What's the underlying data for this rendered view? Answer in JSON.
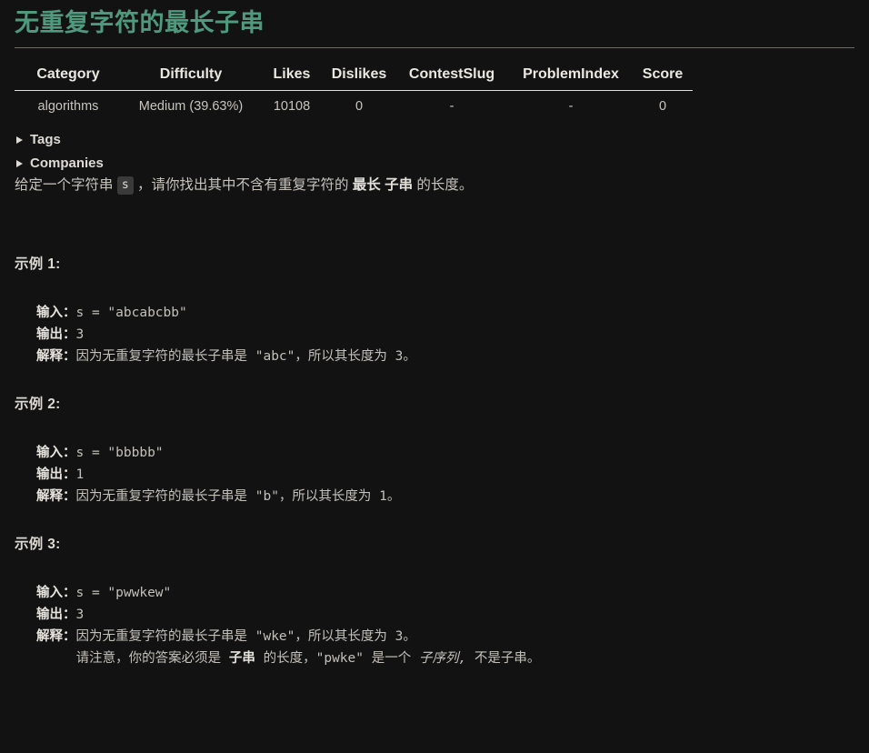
{
  "problem": {
    "title": "无重复字符的最长子串"
  },
  "meta_table": {
    "headers": [
      "Category",
      "Difficulty",
      "Likes",
      "Dislikes",
      "ContestSlug",
      "ProblemIndex",
      "Score"
    ],
    "row": {
      "category": "algorithms",
      "difficulty": "Medium (39.63%)",
      "likes": "10108",
      "dislikes": "0",
      "contest_slug": "-",
      "problem_index": "-",
      "score": "0"
    }
  },
  "disclosures": {
    "tags_label": "Tags",
    "companies_label": "Companies"
  },
  "description": {
    "part1": "给定一个字符串 ",
    "code_s": "s",
    "part2": " ，请你找出其中不含有重复字符的 ",
    "bold1": "最长",
    "part3": " ",
    "bold2": "子串",
    "part4": " 的长度。"
  },
  "examples": [
    {
      "heading": "示例 1:",
      "input_label": "输入：",
      "input_value": "s = \"abcabcbb\"",
      "output_label": "输出：",
      "output_value": "3",
      "explain_label": "解释：",
      "explain_value": "因为无重复字符的最长子串是 \"abc\"，所以其长度为 3。",
      "explain_extra": ""
    },
    {
      "heading": "示例 2:",
      "input_label": "输入：",
      "input_value": "s = \"bbbbb\"",
      "output_label": "输出：",
      "output_value": "1",
      "explain_label": "解释：",
      "explain_value": "因为无重复字符的最长子串是 \"b\"，所以其长度为 1。",
      "explain_extra": ""
    },
    {
      "heading": "示例 3:",
      "input_label": "输入：",
      "input_value": "s = \"pwwkew\"",
      "output_label": "输出：",
      "output_value": "3",
      "explain_label": "解释：",
      "explain_value": "因为无重复字符的最长子串是 \"wke\"，所以其长度为 3。",
      "explain_extra_indent": "     ",
      "explain_extra_a": "请注意，你的答案必须是 ",
      "explain_extra_bold": "子串",
      "explain_extra_b": " 的长度，\"pwke\" 是一个 ",
      "explain_extra_italic": "子序列,",
      "explain_extra_c": " 不是子串。"
    }
  ],
  "colors": {
    "background": "#121212",
    "title": "#4e9a7e",
    "text": "#c6c3bd",
    "heading_text": "#dedbd4",
    "rule": "#6c6a66",
    "code_bg": "#3a3a3a"
  }
}
